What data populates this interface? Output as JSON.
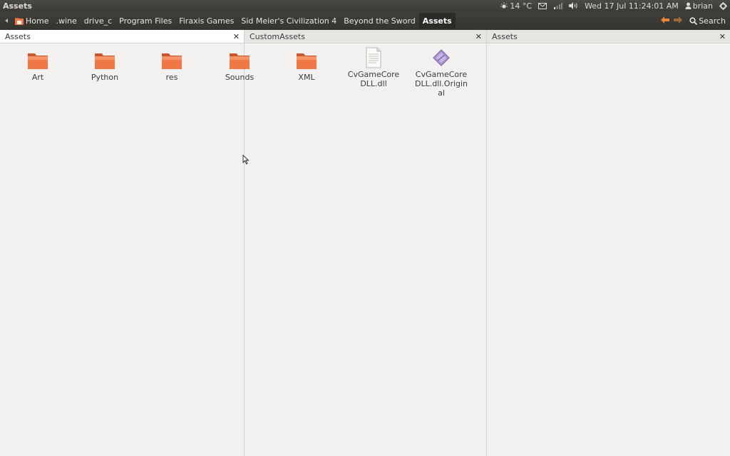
{
  "window": {
    "title": "Assets"
  },
  "panel": {
    "weather": "14 °C",
    "datetime": "Wed 17 Jul 11:24:01 AM",
    "user": "brian"
  },
  "breadcrumbs": [
    {
      "label": "Home"
    },
    {
      "label": ".wine"
    },
    {
      "label": "drive_c"
    },
    {
      "label": "Program Files"
    },
    {
      "label": "Firaxis Games"
    },
    {
      "label": "Sid Meier's Civilization 4"
    },
    {
      "label": "Beyond the Sword"
    },
    {
      "label": "Assets"
    }
  ],
  "toolbar": {
    "search_label": "Search"
  },
  "panes": [
    {
      "title": "Assets"
    },
    {
      "title": "CustomAssets"
    },
    {
      "title": "Assets"
    }
  ],
  "files": [
    {
      "name": "Art",
      "icon": "folder-icon"
    },
    {
      "name": "Python",
      "icon": "folder-icon"
    },
    {
      "name": "res",
      "icon": "folder-icon"
    },
    {
      "name": "Sounds",
      "icon": "folder-icon"
    },
    {
      "name": "XML",
      "icon": "folder-icon"
    },
    {
      "name": "CvGameCoreDLL.dll",
      "icon": "document-icon"
    },
    {
      "name": "CvGameCoreDLL.dll.Original",
      "icon": "diamond-file-icon"
    }
  ],
  "colors": {
    "panel": "#3c3b37",
    "folder": "#f07746",
    "background": "#f2f1f0",
    "accent_arrow": "#e9823a"
  }
}
